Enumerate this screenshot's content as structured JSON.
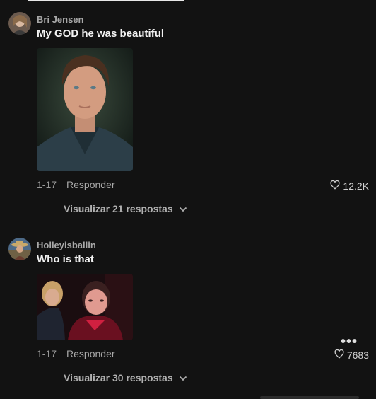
{
  "comments": [
    {
      "username": "Bri Jensen",
      "text": "My GOD he was beautiful",
      "date": "1-17",
      "reply_label": "Responder",
      "likes": "12.2K",
      "view_replies": "Visualizar 21 respostas"
    },
    {
      "username": "Holleyisballin",
      "text": "Who is that",
      "date": "1-17",
      "reply_label": "Responder",
      "likes": "7683",
      "view_replies": "Visualizar 30 respostas",
      "more_options": "•••"
    }
  ],
  "icons": {
    "like": "heart-outline-icon",
    "expand": "chevron-down-icon",
    "more": "more-options-icon"
  },
  "colors": {
    "background": "#121212",
    "text_primary": "#f2f2f2",
    "text_secondary": "#a8a8a8"
  }
}
